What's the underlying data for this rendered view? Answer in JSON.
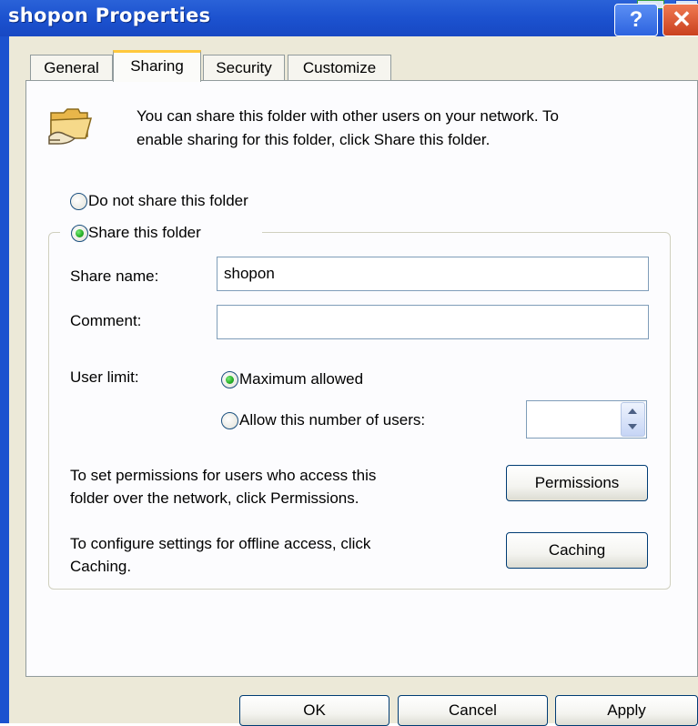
{
  "window": {
    "title": "shopon Properties"
  },
  "title_buttons": [
    {
      "name": "help-button",
      "glyph": "?"
    },
    {
      "name": "close-button",
      "glyph": "✕"
    }
  ],
  "tabs": [
    {
      "label": "General",
      "active": false
    },
    {
      "label": "Sharing",
      "active": true
    },
    {
      "label": "Security",
      "active": false
    },
    {
      "label": "Customize",
      "active": false
    }
  ],
  "intro": {
    "icon": "shared-folder-icon",
    "line1": "You can share this folder with other users on your network.  To",
    "line2": "enable sharing for this folder, click Share this folder."
  },
  "sharing_options": {
    "do_not_share": {
      "label": "Do not share this folder",
      "selected": false
    },
    "share": {
      "label": "Share this folder",
      "selected": true
    }
  },
  "fields": {
    "share_name_label": "Share name:",
    "share_name_value": "shopon",
    "comment_label": "Comment:",
    "comment_value": ""
  },
  "user_limit": {
    "label": "User limit:",
    "maximum": {
      "label": "Maximum allowed",
      "selected": true
    },
    "allow_number": {
      "label": "Allow this number of users:",
      "selected": false
    },
    "number_value": ""
  },
  "permissions": {
    "text1": "To set permissions for users who access this",
    "text2": "folder over the network, click Permissions.",
    "button": "Permissions"
  },
  "caching": {
    "text1": "To configure settings for offline access, click",
    "text2": "Caching.",
    "button": "Caching"
  },
  "footer": {
    "ok": "OK",
    "cancel": "Cancel",
    "apply": "Apply"
  },
  "colors": {
    "titlebar": "#1c52cf",
    "dialog_bg": "#ece9d8",
    "panel_bg": "#fcfcfe",
    "active_tab_accent": "#ffc83c",
    "radio_selected": "#29b329"
  }
}
